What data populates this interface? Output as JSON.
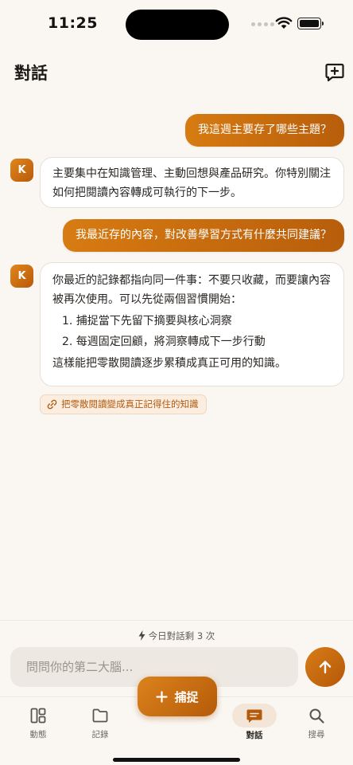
{
  "status_bar": {
    "time": "11:25"
  },
  "header": {
    "title": "對話",
    "new_chat_icon": "new-chat-icon"
  },
  "messages": [
    {
      "role": "user",
      "text": "我這週主要存了哪些主題？"
    },
    {
      "role": "assistant",
      "avatar": "K",
      "text": "主要集中在知識管理、主動回想與產品研究。你特別關注如何把閱讀內容轉成可執行的下一步。"
    },
    {
      "role": "user",
      "text": "我最近存的內容，對改善學習方式有什麼共同建議？"
    },
    {
      "role": "assistant",
      "avatar": "K",
      "intro": "你最近的記錄都指向同一件事：不要只收藏，而要讓內容被再次使用。可以先從兩個習慣開始：",
      "list": [
        "1. 捕捉當下先留下摘要與核心洞察",
        "2. 每週固定回顧，將洞察轉成下一步行動"
      ],
      "outro": "這樣能把零散閱讀逐步累積成真正可用的知識。",
      "source": {
        "icon": "link-icon",
        "label": "把零散閱讀變成真正記得住的知識"
      }
    }
  ],
  "composer": {
    "quota": "今日對話剩 3 次",
    "placeholder": "問問你的第二大腦...",
    "send_icon": "arrow-up-icon"
  },
  "capture": {
    "label": "捕捉",
    "icon": "plus-icon"
  },
  "tabs": [
    {
      "label": "動態",
      "icon": "dashboard-icon",
      "active": false
    },
    {
      "label": "記錄",
      "icon": "folder-icon",
      "active": false
    },
    {
      "label": "對話",
      "icon": "chat-icon",
      "active": true
    },
    {
      "label": "搜尋",
      "icon": "search-icon",
      "active": false
    }
  ],
  "colors": {
    "accent": "#c9690f",
    "background": "#faf7f2",
    "active_tab_bg": "#f3e6d8"
  }
}
